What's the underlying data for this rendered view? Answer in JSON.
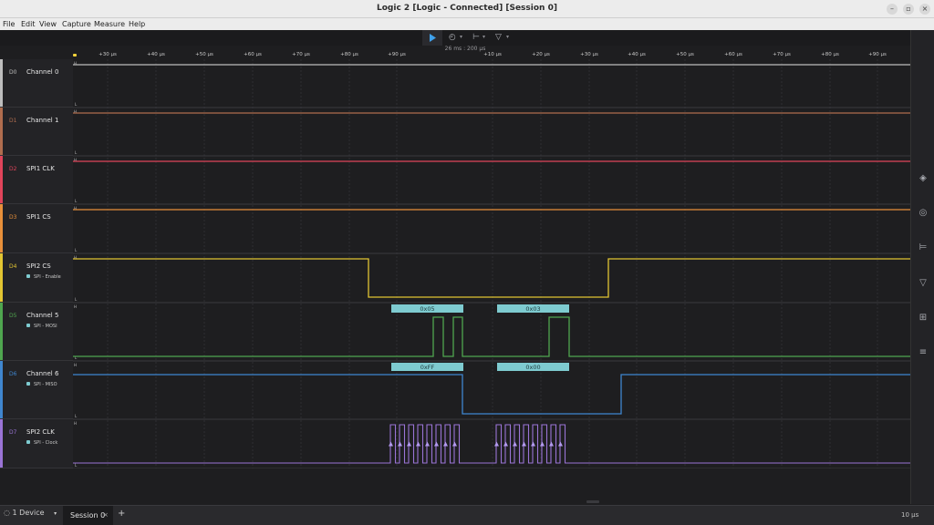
{
  "window": {
    "title": "Logic 2 [Logic - Connected] [Session 0]",
    "controls": [
      "minimize-icon",
      "maximize-icon",
      "close-icon"
    ]
  },
  "menu": [
    "File",
    "Edit",
    "View",
    "Capture",
    "Measure",
    "Help"
  ],
  "toolbar": {
    "play_icon": "play-icon",
    "zoom_info": "26 ms : 200 µs"
  },
  "ruler": {
    "ticks": [
      "+30 µs",
      "+40 µs",
      "+50 µs",
      "+60 µs",
      "+70 µs",
      "+80 µs",
      "+90 µs",
      "+10 µs",
      "+20 µs",
      "+30 µs",
      "+40 µs",
      "+50 µs",
      "+60 µs",
      "+70 µs",
      "+80 µs",
      "+90 µs"
    ]
  },
  "channels": [
    {
      "id": "D0",
      "name": "Channel 0",
      "analyzer": "",
      "color": "#bdbdbd"
    },
    {
      "id": "D1",
      "name": "Channel 1",
      "analyzer": "",
      "color": "#b06d4e"
    },
    {
      "id": "D2",
      "name": "SPI1 CLK",
      "analyzer": "",
      "color": "#e0445a"
    },
    {
      "id": "D3",
      "name": "SPI1 CS",
      "analyzer": "",
      "color": "#e8903a"
    },
    {
      "id": "D4",
      "name": "SPI2 CS",
      "analyzer": "SPI - Enable",
      "color": "#e2c532"
    },
    {
      "id": "D5",
      "name": "Channel 5",
      "analyzer": "SPI - MOSI",
      "color": "#4fa64f"
    },
    {
      "id": "D6",
      "name": "Channel 6",
      "analyzer": "SPI - MISO",
      "color": "#3f86cf"
    },
    {
      "id": "D7",
      "name": "SPI2 CLK",
      "analyzer": "SPI - Clock",
      "color": "#9a74d6"
    }
  ],
  "decodes": {
    "mosi": [
      "0x05",
      "0x03"
    ],
    "miso": [
      "0xFF",
      "0x00"
    ]
  },
  "level_marks": {
    "high": "H",
    "low": "L"
  },
  "sidebar": [
    "analyzers-icon",
    "timing-markers-icon",
    "measurements-icon",
    "annotations-icon",
    "extensions-icon",
    "notes-icon"
  ],
  "bottom": {
    "device_label": "1 Device",
    "session_label": "Session 0",
    "close_label": "×",
    "add_label": "+",
    "timescale": "10 µs"
  },
  "colors": {
    "decode_box": "#7ecbd0",
    "grid": "#2e2e32",
    "background": "#1e1e20"
  }
}
